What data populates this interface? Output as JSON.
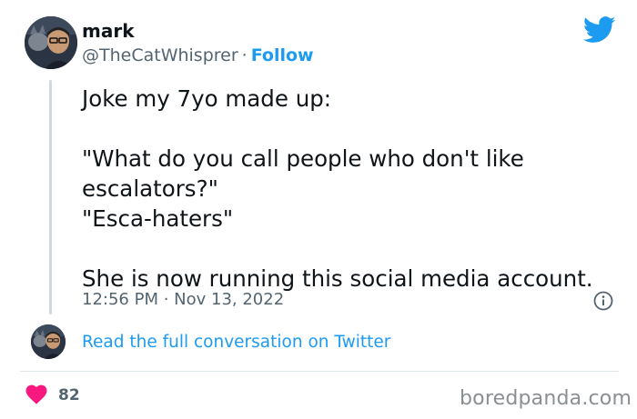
{
  "author": {
    "name": "mark",
    "handle": "@TheCatWhisprer",
    "separator": "·",
    "follow_label": "Follow"
  },
  "tweet": {
    "lines": [
      "Joke my 7yo made up:",
      "",
      "\"What do you call people who don't like",
      "escalators?\"",
      "\"Esca-haters\"",
      "",
      "She is now running this social media account."
    ],
    "timestamp": "12:56 PM · Nov 13, 2022"
  },
  "conversation_link": "Read the full conversation on Twitter",
  "likes_count": "82",
  "watermark": "boredpanda.com",
  "icons": {
    "brand": "twitter-bird-icon",
    "info": "info-icon",
    "like": "heart-icon"
  },
  "colors": {
    "accent": "#1d9bf0",
    "heart": "#f91880",
    "muted": "#536471",
    "text": "#0f1419"
  }
}
